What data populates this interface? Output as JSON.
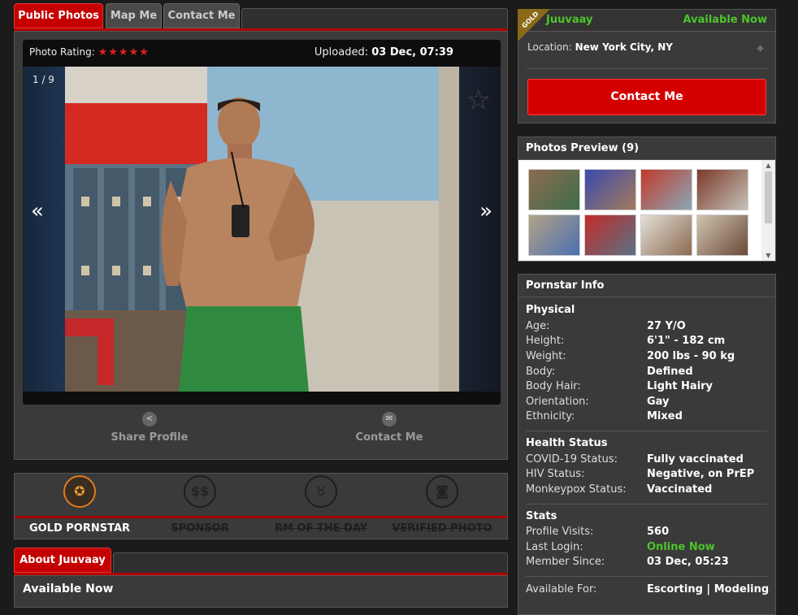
{
  "tabs": {
    "public_photos": "Public Photos",
    "map_me": "Map Me",
    "contact_me": "Contact Me"
  },
  "photo": {
    "rating_label": "Photo Rating:",
    "stars": "★★★★★",
    "uploaded_label": "Uploaded:",
    "uploaded_value": "03 Dec, 07:39",
    "counter": "1 / 9",
    "prev": "«",
    "next": "»",
    "favorite_icon": "☆"
  },
  "actions": {
    "share": "Share Profile",
    "contact": "Contact Me"
  },
  "badges": [
    {
      "name": "GOLD PORNSTAR",
      "icon": "rosette-icon",
      "active": true
    },
    {
      "name": "SPONSOR",
      "icon": "dollar-icon",
      "active": false
    },
    {
      "name": "RM OF THE DAY",
      "icon": "horns-icon",
      "active": false
    },
    {
      "name": "VERIFIED PHOTO",
      "icon": "camera-icon",
      "active": false
    }
  ],
  "about": {
    "tab": "About Juuvaay",
    "heading": "Available Now"
  },
  "profile": {
    "ribbon": "GOLD",
    "name": "Juuvaay",
    "status": "Available Now",
    "location_label": "Location:",
    "location_value": "New York City, NY",
    "contact_button": "Contact Me"
  },
  "preview": {
    "title": "Photos Preview (9)"
  },
  "info": {
    "title": "Pornstar Info",
    "physical_title": "Physical",
    "physical": [
      {
        "label": "Age:",
        "value": "27 Y/O"
      },
      {
        "label": "Height:",
        "value": "6'1\" - 182 cm"
      },
      {
        "label": "Weight:",
        "value": "200 lbs - 90 kg"
      },
      {
        "label": "Body:",
        "value": "Defined"
      },
      {
        "label": "Body Hair:",
        "value": "Light Hairy"
      },
      {
        "label": "Orientation:",
        "value": "Gay"
      },
      {
        "label": "Ethnicity:",
        "value": "Mixed"
      }
    ],
    "health_title": "Health Status",
    "health": [
      {
        "label": "COVID-19 Status:",
        "value": "Fully vaccinated"
      },
      {
        "label": "HIV Status:",
        "value": "Negative, on PrEP"
      },
      {
        "label": "Monkeypox Status:",
        "value": "Vaccinated"
      }
    ],
    "stats_title": "Stats",
    "stats": [
      {
        "label": "Profile Visits:",
        "value": "560"
      },
      {
        "label": "Last Login:",
        "value": "Online Now"
      },
      {
        "label": "Member Since:",
        "value": "03 Dec, 05:23"
      }
    ],
    "available_label": "Available For:",
    "available_value": "Escorting | Modeling"
  },
  "colors": {
    "accent_red": "#c40000",
    "online_green": "#4cc52a",
    "gold": "#e07a20"
  }
}
